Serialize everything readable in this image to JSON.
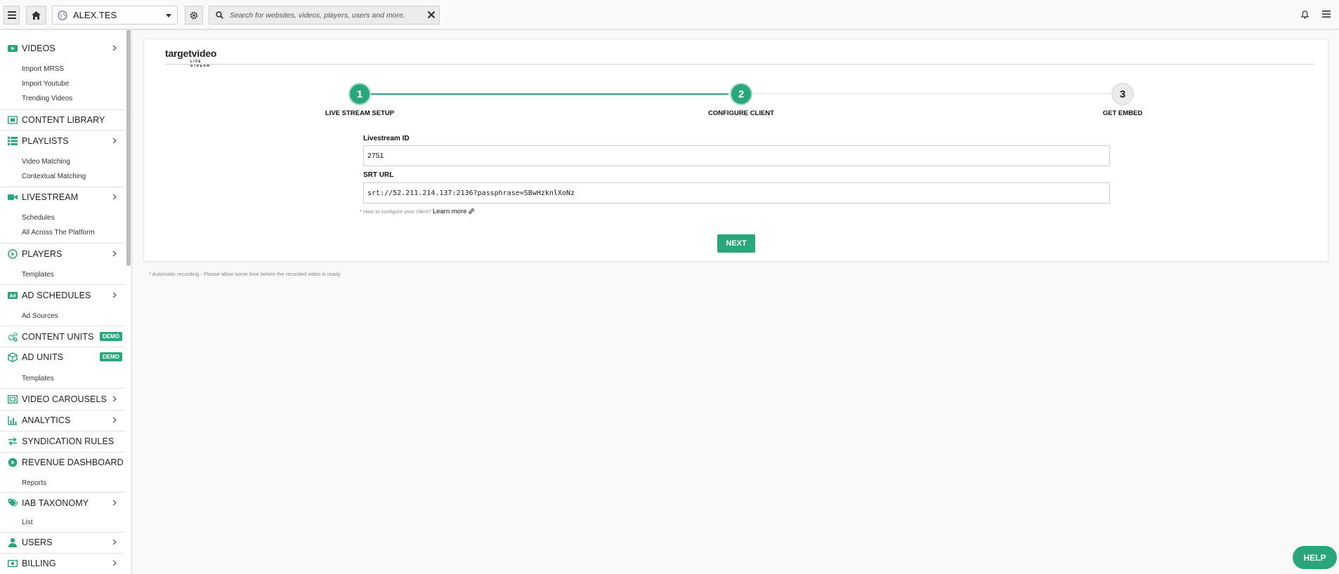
{
  "topbar": {
    "site_name": "ALEX.TES",
    "search_placeholder": "Search for websites, videos, players, users and more.",
    "icons": {
      "menu": "hamburger-icon",
      "home": "home-icon",
      "site": "globe-icon",
      "settings": "gear-icon",
      "search": "search-icon",
      "clear": "close-icon",
      "notifications": "bell-icon",
      "right_menu": "hamburger-icon"
    }
  },
  "sidebar": {
    "items": [
      {
        "label": "VIDEOS",
        "icon": "video-icon",
        "chevron": true,
        "subitems": [
          "Import MRSS",
          "Import Youtube",
          "Trending Videos"
        ]
      },
      {
        "label": "CONTENT LIBRARY",
        "icon": "film-icon",
        "chevron": false,
        "subitems": []
      },
      {
        "label": "PLAYLISTS",
        "icon": "list-icon",
        "chevron": true,
        "subitems": [
          "Video Matching",
          "Contextual Matching"
        ]
      },
      {
        "label": "LIVESTREAM",
        "icon": "camera-icon",
        "chevron": true,
        "subitems": [
          "Schedules",
          "All Across The Platform"
        ]
      },
      {
        "label": "PLAYERS",
        "icon": "play-circle-icon",
        "chevron": true,
        "subitems": [
          "Templates"
        ]
      },
      {
        "label": "AD SCHEDULES",
        "icon": "ad-icon",
        "chevron": true,
        "subitems": [
          "Ad Sources"
        ]
      },
      {
        "label": "CONTENT UNITS",
        "icon": "cogs-icon",
        "chevron": false,
        "badge": "DEMO",
        "subitems": []
      },
      {
        "label": "AD UNITS",
        "icon": "cube-icon",
        "chevron": false,
        "badge": "DEMO",
        "subitems": [
          "Templates"
        ]
      },
      {
        "label": "VIDEO CAROUSELS",
        "icon": "carousel-icon",
        "chevron": true,
        "subitems": []
      },
      {
        "label": "ANALYTICS",
        "icon": "bar-chart-icon",
        "chevron": true,
        "subitems": []
      },
      {
        "label": "SYNDICATION RULES",
        "icon": "exchange-icon",
        "chevron": false,
        "subitems": []
      },
      {
        "label": "REVENUE DASHBOARD",
        "icon": "play-solid-icon",
        "chevron": false,
        "subitems": [
          "Reports"
        ]
      },
      {
        "label": "IAB TAXONOMY",
        "icon": "tags-icon",
        "chevron": true,
        "subitems": [
          "List"
        ]
      },
      {
        "label": "USERS",
        "icon": "user-icon",
        "chevron": true,
        "subitems": []
      },
      {
        "label": "BILLING",
        "icon": "money-icon",
        "chevron": true,
        "subitems": []
      }
    ]
  },
  "main": {
    "logo_text": "targetvideo",
    "logo_subtext": "LIVE STREAM",
    "steps": [
      {
        "number": "1",
        "label": "LIVE STREAM SETUP",
        "state": "complete"
      },
      {
        "number": "2",
        "label": "CONFIGURE CLIENT",
        "state": "active"
      },
      {
        "number": "3",
        "label": "GET EMBED",
        "state": "pending"
      }
    ],
    "livestream_id_label": "Livestream ID",
    "livestream_id_value": "2751",
    "srt_url_label": "SRT URL",
    "srt_url_value": "srt://52.211.214.137:2136?passphrase=SBwHzknlXoNz",
    "help_asterisk": "*",
    "help_text": "How to configure your client?",
    "learn_more": "Learn more",
    "next_label": "NEXT",
    "footnote_asterisk": "*",
    "footnote_text": "Automatic recording - Please allow some time before the recorded video is ready",
    "help_button": "HELP"
  },
  "colors": {
    "accent": "#2aa77a",
    "asterisk": "#d9534f"
  }
}
